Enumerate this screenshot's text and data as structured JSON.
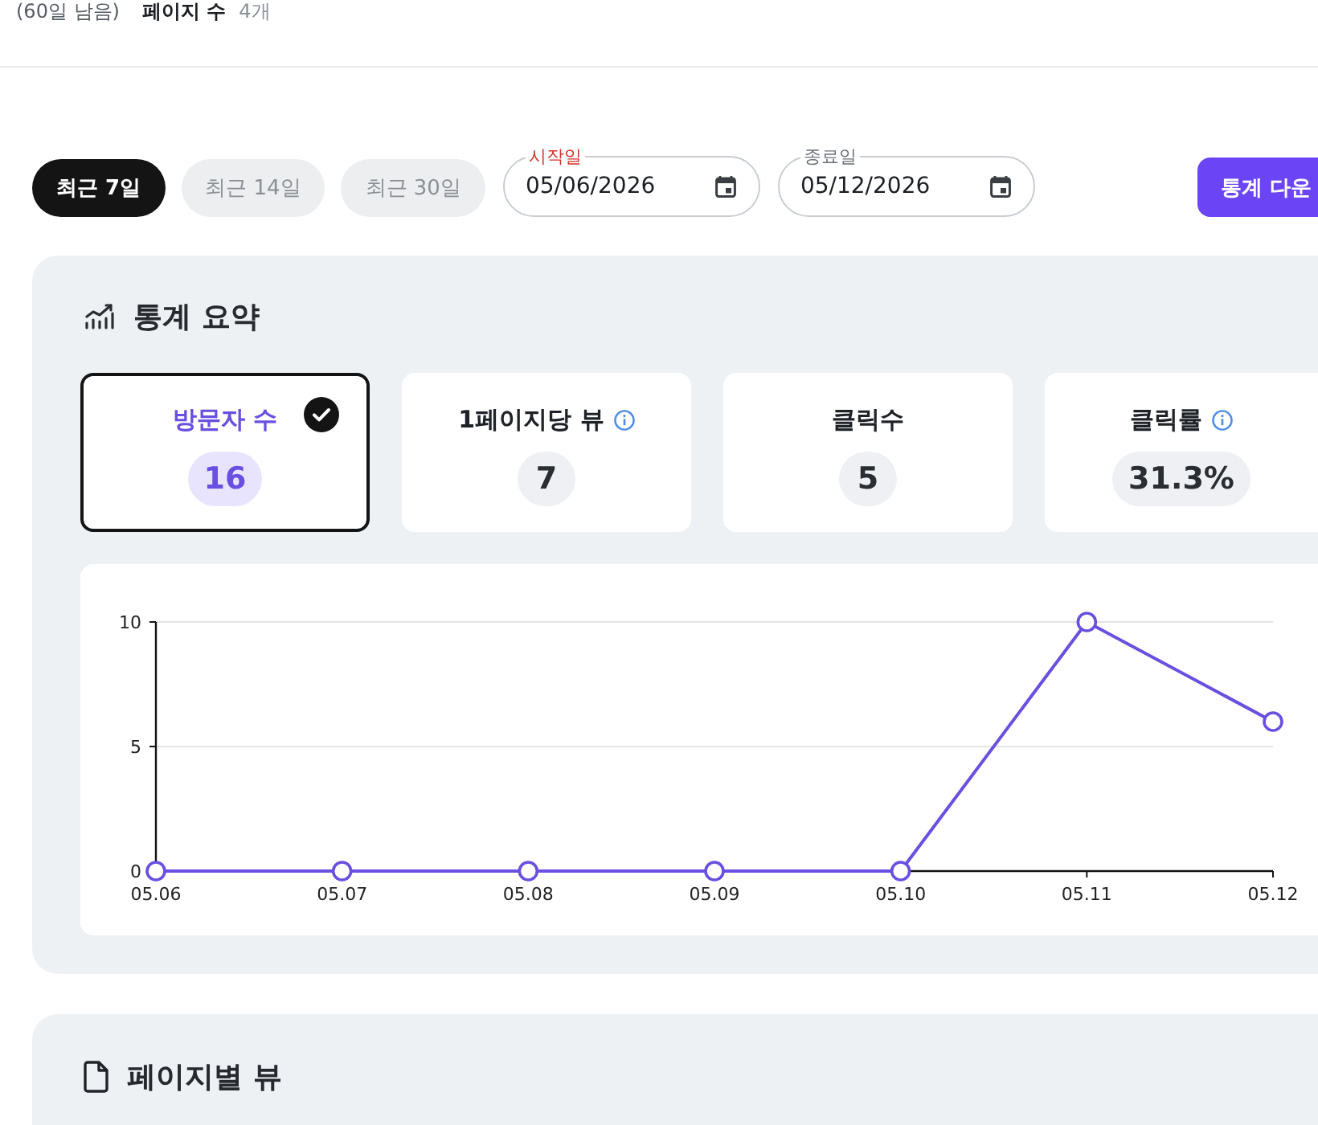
{
  "top_bar": {
    "note": "(60일 남음)",
    "stat_label": "페이지 수",
    "stat_value": "4개"
  },
  "filters": {
    "ranges": [
      {
        "label": "최근 7일",
        "selected": true
      },
      {
        "label": "최근 14일",
        "selected": false
      },
      {
        "label": "최근 30일",
        "selected": false
      }
    ],
    "date_fields": [
      {
        "label": "시작일",
        "value": "05/06/2026",
        "error": true
      },
      {
        "label": "종료일",
        "value": "05/12/2026",
        "error": false
      }
    ],
    "download_button": "통계 다운"
  },
  "summary": {
    "title": "통계 요약",
    "metrics": [
      {
        "label": "방문자 수",
        "value": "16",
        "selected": true,
        "info": false
      },
      {
        "label": "1페이지당 뷰",
        "value": "7",
        "selected": false,
        "info": true
      },
      {
        "label": "클릭수",
        "value": "5",
        "selected": false,
        "info": false
      },
      {
        "label": "클릭률",
        "value": "31.3%",
        "selected": false,
        "info": true
      }
    ],
    "chart_data": {
      "type": "line",
      "categories": [
        "05.06",
        "05.07",
        "05.08",
        "05.09",
        "05.10",
        "05.11",
        "05.12"
      ],
      "series": [
        {
          "color": "#6a4fe0",
          "marker": true,
          "values": [
            0,
            0,
            0,
            0,
            0,
            10,
            6
          ]
        }
      ],
      "ylim": [
        0,
        10
      ],
      "yticks": [
        0,
        5,
        10
      ]
    }
  },
  "page_views": {
    "title": "페이지별 뷰"
  }
}
